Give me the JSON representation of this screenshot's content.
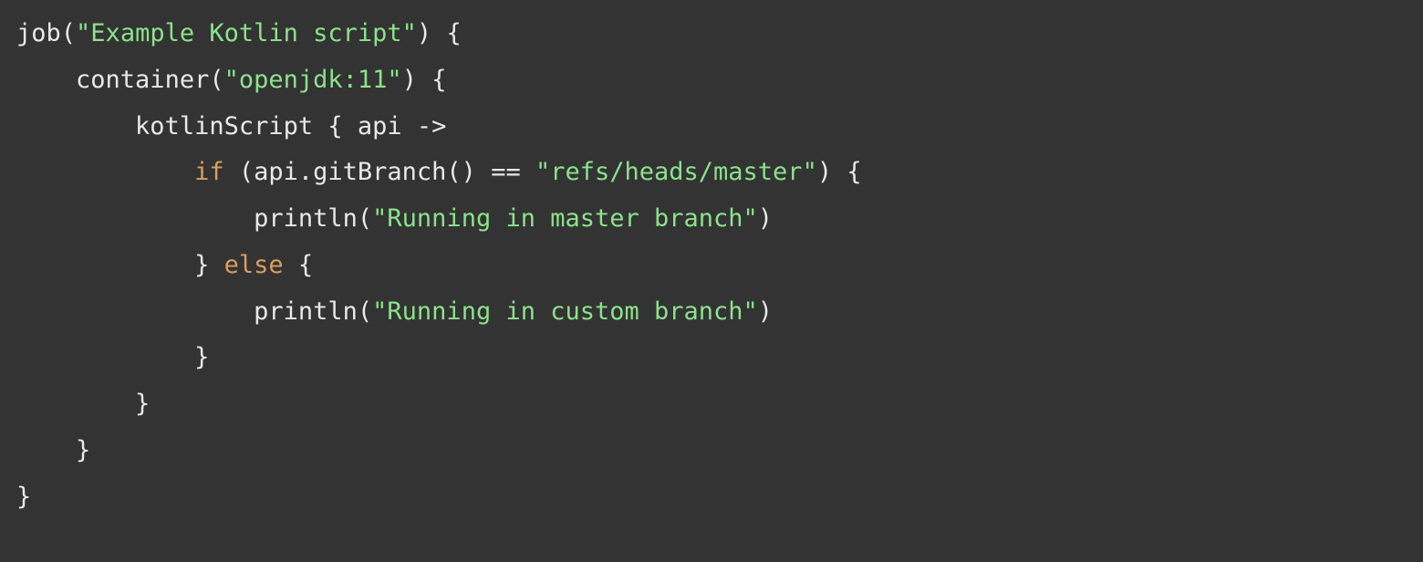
{
  "code": {
    "line1": {
      "fn": "job",
      "p1": "(",
      "str": "\"Example Kotlin script\"",
      "p2": ")",
      "brace": " {"
    },
    "line2": {
      "indent": "    ",
      "fn": "container",
      "p1": "(",
      "str": "\"openjdk:11\"",
      "p2": ")",
      "brace": " {"
    },
    "line3": {
      "indent": "        ",
      "fn": "kotlinScript",
      "rest": " { api ->"
    },
    "line4": {
      "indent": "            ",
      "kw": "if",
      "mid": " (api.gitBranch() == ",
      "str": "\"refs/heads/master\"",
      "end": ") {"
    },
    "line5": {
      "indent": "                ",
      "fn": "println",
      "p1": "(",
      "str": "\"Running in master branch\"",
      "p2": ")"
    },
    "line6": {
      "indent": "            ",
      "close": "} ",
      "kw": "else",
      "open": " {"
    },
    "line7": {
      "indent": "                ",
      "fn": "println",
      "p1": "(",
      "str": "\"Running in custom branch\"",
      "p2": ")"
    },
    "line8": {
      "indent": "            ",
      "close": "}"
    },
    "line9": {
      "indent": "        ",
      "close": "}"
    },
    "line10": {
      "indent": "    ",
      "close": "}"
    },
    "line11": {
      "close": "}"
    }
  }
}
